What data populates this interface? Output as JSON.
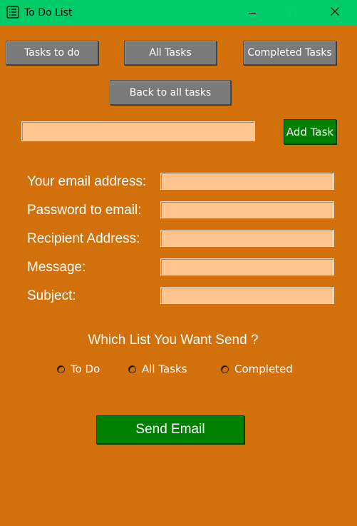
{
  "window": {
    "title": "To Do List"
  },
  "nav": {
    "tasks_to_do": "Tasks to do",
    "all_tasks": "All Tasks",
    "completed_tasks": "Completed Tasks",
    "back_to_all": "Back to all tasks"
  },
  "task_entry": {
    "value": "",
    "add_label": "Add Task"
  },
  "email_form": {
    "email_label": "Your email address:",
    "password_label": "Password to email:",
    "recipient_label": "Recipient Address:",
    "message_label": "Message:",
    "subject_label": "Subject:",
    "question": "Which List You Want Send ?",
    "options": [
      "To Do",
      "All Tasks",
      "Completed"
    ],
    "send_label": "Send Email"
  },
  "colors": {
    "background": "#d2700c",
    "titlebar": "#00cc6a",
    "button_gray": "#7a7a7a",
    "button_green": "#008000",
    "entry": "#ffc48f"
  }
}
